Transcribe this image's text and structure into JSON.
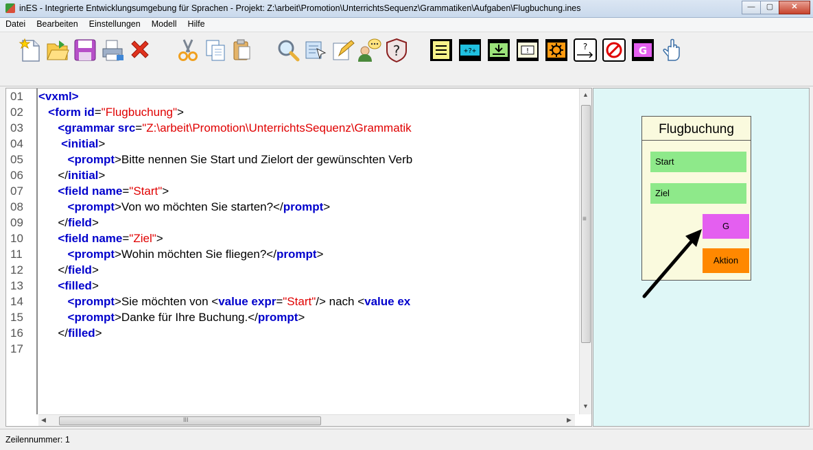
{
  "window": {
    "title": "inES - Integrierte Entwicklungsumgebung für Sprachen - Projekt: Z:\\arbeit\\Promotion\\UnterrichtsSequenz\\Grammatiken\\Aufgaben\\Flugbuchung.ines",
    "minimize": "—",
    "maximize": "▢",
    "close": "✕"
  },
  "menu": [
    "Datei",
    "Bearbeiten",
    "Einstellungen",
    "Modell",
    "Hilfe"
  ],
  "toolbar": {
    "icons": [
      "new-file-icon",
      "open-folder-icon",
      "save-icon",
      "print-icon",
      "delete-icon",
      "cut-icon",
      "copy-icon",
      "paste-icon",
      "search-icon",
      "select-icon",
      "edit-icon",
      "user-chat-icon",
      "help-icon",
      "form-element-icon",
      "input-element-icon",
      "insert-element-icon",
      "block-element-icon",
      "gear-element-icon",
      "prompt-element-icon",
      "cancel-element-icon",
      "grammar-element-icon",
      "pointer-hand-icon"
    ],
    "labels": {
      "input": "+?+",
      "prompt": "?",
      "grammar": "G",
      "block": "!"
    }
  },
  "editor": {
    "line_numbers": [
      "01",
      "02",
      "03",
      "04",
      "05",
      "06",
      "07",
      "08",
      "09",
      "10",
      "11",
      "12",
      "13",
      "14",
      "15",
      "16",
      "17"
    ],
    "lines": [
      [
        [
          "t",
          "<vxml>"
        ]
      ],
      [
        [
          "p",
          "   "
        ],
        [
          "t",
          "<form id"
        ],
        [
          "p",
          "="
        ],
        [
          "s",
          "\"Flugbuchung\""
        ],
        [
          "p",
          ">"
        ]
      ],
      [
        [
          "p",
          "      "
        ],
        [
          "t",
          "<grammar src"
        ],
        [
          "p",
          "="
        ],
        [
          "s",
          "\"Z:\\arbeit\\Promotion\\UnterrichtsSequenz\\Grammatik"
        ]
      ],
      [
        [
          "p",
          "       "
        ],
        [
          "t",
          "<initial"
        ],
        [
          "p",
          ">"
        ]
      ],
      [
        [
          "p",
          "         "
        ],
        [
          "t",
          "<prompt"
        ],
        [
          "p",
          ">Bitte nennen Sie Start und Zielort der gewünschten Verb"
        ]
      ],
      [
        [
          "p",
          "      "
        ],
        [
          "p",
          "</"
        ],
        [
          "t",
          "initial"
        ],
        [
          "p",
          ">"
        ]
      ],
      [
        [
          "p",
          "      "
        ],
        [
          "t",
          "<field name"
        ],
        [
          "p",
          "="
        ],
        [
          "s",
          "\"Start\""
        ],
        [
          "p",
          ">"
        ]
      ],
      [
        [
          "p",
          "         "
        ],
        [
          "t",
          "<prompt"
        ],
        [
          "p",
          ">Von wo möchten Sie starten?</"
        ],
        [
          "t",
          "prompt"
        ],
        [
          "p",
          ">"
        ]
      ],
      [
        [
          "p",
          "      "
        ],
        [
          "p",
          "</"
        ],
        [
          "t",
          "field"
        ],
        [
          "p",
          ">"
        ]
      ],
      [
        [
          "p",
          "      "
        ],
        [
          "t",
          "<field name"
        ],
        [
          "p",
          "="
        ],
        [
          "s",
          "\"Ziel\""
        ],
        [
          "p",
          ">"
        ]
      ],
      [
        [
          "p",
          "         "
        ],
        [
          "t",
          "<prompt"
        ],
        [
          "p",
          ">Wohin möchten Sie fliegen?</"
        ],
        [
          "t",
          "prompt"
        ],
        [
          "p",
          ">"
        ]
      ],
      [
        [
          "p",
          "      "
        ],
        [
          "p",
          "</"
        ],
        [
          "t",
          "field"
        ],
        [
          "p",
          ">"
        ]
      ],
      [
        [
          "p",
          "      "
        ],
        [
          "t",
          "<filled"
        ],
        [
          "p",
          ">"
        ]
      ],
      [
        [
          "p",
          "         "
        ],
        [
          "t",
          "<prompt"
        ],
        [
          "p",
          ">Sie möchten von <"
        ],
        [
          "t",
          "value expr"
        ],
        [
          "p",
          "="
        ],
        [
          "s",
          "\"Start\""
        ],
        [
          "p",
          "/> nach <"
        ],
        [
          "t",
          "value ex"
        ]
      ],
      [
        [
          "p",
          "         "
        ],
        [
          "t",
          "<prompt"
        ],
        [
          "p",
          ">Danke für Ihre Buchung.</"
        ],
        [
          "t",
          "prompt"
        ],
        [
          "p",
          ">"
        ]
      ],
      [
        [
          "p",
          "      "
        ],
        [
          "p",
          "</"
        ],
        [
          "t",
          "filled"
        ],
        [
          "p",
          ">"
        ]
      ],
      [
        [
          "p",
          ""
        ]
      ]
    ],
    "hscroll_label": "III",
    "vscroll_grip": "≡"
  },
  "diagram": {
    "form_title": "Flugbuchung",
    "fields": [
      "Start",
      "Ziel"
    ],
    "grammar_button": "G",
    "action_button": "Aktion"
  },
  "status": {
    "text": "Zeilennummer: 1"
  },
  "colors": {
    "tag": "#0000cc",
    "string": "#e00000",
    "diagram_bg": "#dff7f7",
    "field": "#8ee98a",
    "grammar": "#e45ff0",
    "action": "#ff8800"
  }
}
